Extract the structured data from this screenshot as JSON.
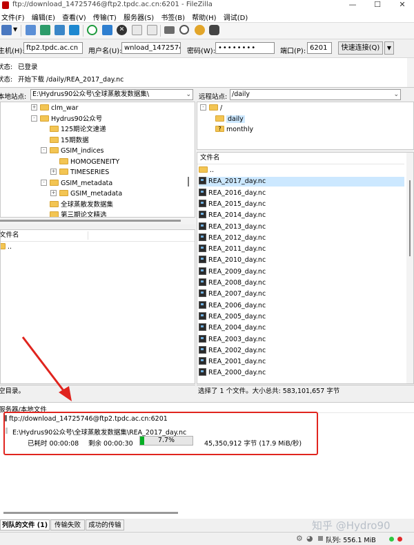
{
  "window": {
    "title": "ftp://download_14725746@ftp2.tpdc.ac.cn:6201 - FileZilla"
  },
  "menu": [
    "文件(F)",
    "编辑(E)",
    "查看(V)",
    "传输(T)",
    "服务器(S)",
    "书签(B)",
    "帮助(H)",
    "调试(D)"
  ],
  "quickconnect": {
    "host_label": "主机(H):",
    "host": "ftp2.tpdc.ac.cn",
    "user_label": "用户名(U):",
    "user": "wnload_14725746",
    "pass_label": "密码(W):",
    "pass": "••••••••",
    "port_label": "端口(P):",
    "port": "6201",
    "connect_label": "快速连接(Q)"
  },
  "log": [
    {
      "label": "状态:",
      "text": "已登录"
    },
    {
      "label": "状态:",
      "text": "开始下载 /daily/REA_2017_day.nc"
    }
  ],
  "local": {
    "site_label": "本地站点:",
    "path": "E:\\Hydrus90公众号\\全球蒸散发数据集\\",
    "tree": [
      {
        "label": "clm_war",
        "indent": 0,
        "exp": "+"
      },
      {
        "label": "Hydrus90公众号",
        "indent": 0,
        "exp": "-"
      },
      {
        "label": "125期论文速递",
        "indent": 1,
        "exp": ""
      },
      {
        "label": "15期数据",
        "indent": 1,
        "exp": ""
      },
      {
        "label": "GSIM_indices",
        "indent": 1,
        "exp": "-"
      },
      {
        "label": "HOMOGENEITY",
        "indent": 2,
        "exp": ""
      },
      {
        "label": "TIMESERIES",
        "indent": 2,
        "exp": "+"
      },
      {
        "label": "GSIM_metadata",
        "indent": 1,
        "exp": "-"
      },
      {
        "label": "GSIM_metadata",
        "indent": 2,
        "exp": "+"
      },
      {
        "label": "全球蒸散发数据集",
        "indent": 1,
        "exp": ""
      },
      {
        "label": "第三期论文精选",
        "indent": 1,
        "exp": ""
      }
    ],
    "file_header": "文件名",
    "files": [
      ".."
    ],
    "status": "空目录。"
  },
  "remote": {
    "site_label": "远程站点:",
    "path": "/daily",
    "tree": [
      {
        "label": "/",
        "indent": 0,
        "type": "folder"
      },
      {
        "label": "daily",
        "indent": 1,
        "type": "folder"
      },
      {
        "label": "monthly",
        "indent": 1,
        "type": "unknown"
      }
    ],
    "file_header": "文件名",
    "files": [
      "..",
      "REA_2017_day.nc",
      "REA_2016_day.nc",
      "REA_2015_day.nc",
      "REA_2014_day.nc",
      "REA_2013_day.nc",
      "REA_2012_day.nc",
      "REA_2011_day.nc",
      "REA_2010_day.nc",
      "REA_2009_day.nc",
      "REA_2008_day.nc",
      "REA_2007_day.nc",
      "REA_2006_day.nc",
      "REA_2005_day.nc",
      "REA_2004_day.nc",
      "REA_2003_day.nc",
      "REA_2002_day.nc",
      "REA_2001_day.nc",
      "REA_2000_day.nc"
    ],
    "selected_index": 1,
    "status": "选择了 1 个文件。大小总共: 583,101,657 字节"
  },
  "queue": {
    "header": "服务器/本地文件",
    "server": "ftp://download_14725746@ftp2.tpdc.ac.cn:6201",
    "local_file": "E:\\Hydrus90公众号\\全球蒸散发数据集\\REA_2017_day.nc",
    "elapsed": "已耗时 00:00:08",
    "remaining": "剩余 00:00:30",
    "progress_label": "7.7%",
    "progress_fraction": 0.077,
    "bytes": "45,350,912 字节 (17.9 MiB/秒)"
  },
  "tabs": [
    "列队的文件 (1)",
    "传输失败",
    "成功的传输"
  ],
  "bottom": {
    "queue_label": "队列: 556.1 MiB"
  },
  "watermark": "知乎 @Hydro90"
}
